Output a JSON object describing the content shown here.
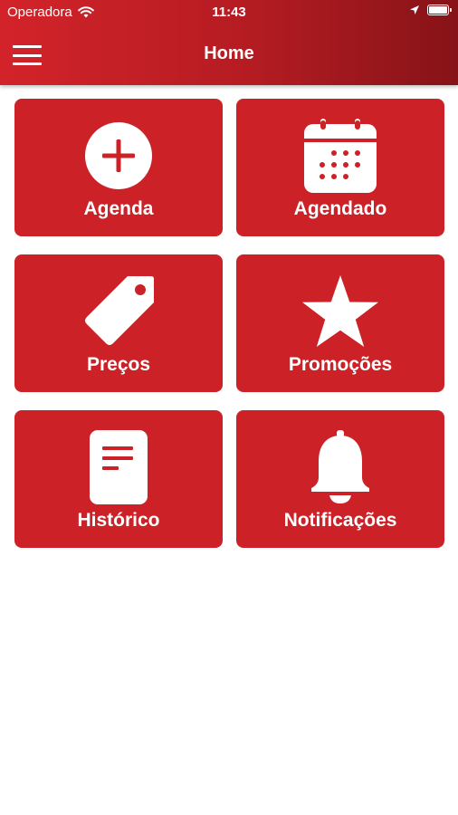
{
  "status_bar": {
    "carrier": "Operadora",
    "time": "11:43"
  },
  "header": {
    "title": "Home"
  },
  "tiles": [
    {
      "label": "Agenda",
      "icon": "plus-circle-icon"
    },
    {
      "label": "Agendado",
      "icon": "calendar-icon"
    },
    {
      "label": "Preços",
      "icon": "price-tag-icon"
    },
    {
      "label": "Promoções",
      "icon": "star-icon"
    },
    {
      "label": "Histórico",
      "icon": "document-icon"
    },
    {
      "label": "Notificações",
      "icon": "bell-icon"
    }
  ],
  "colors": {
    "brand_red": "#cc2127",
    "header_dark": "#861317",
    "background": "#ffffff"
  }
}
